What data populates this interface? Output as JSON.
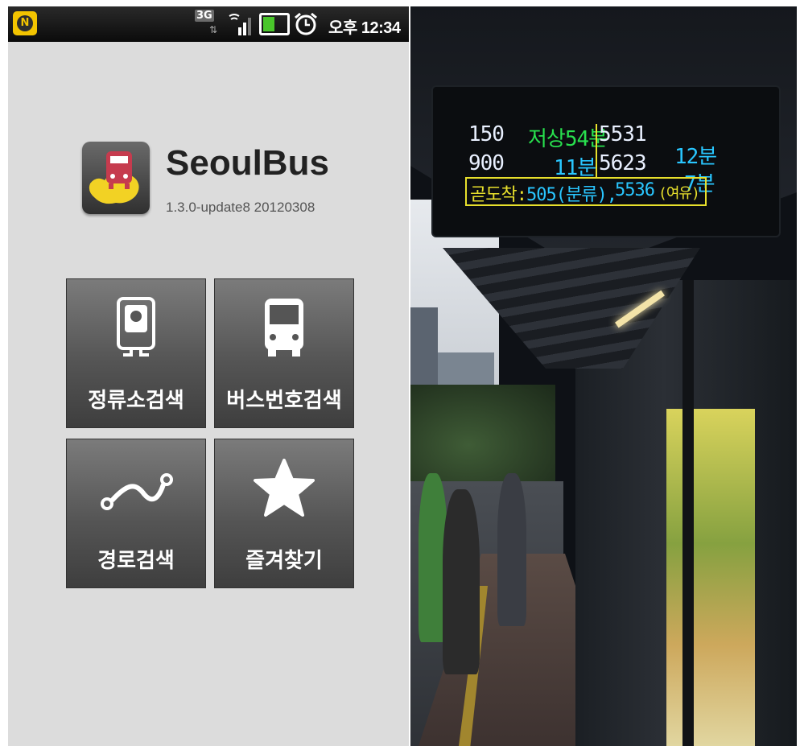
{
  "status_bar": {
    "notification_icon": "N",
    "network": "3G",
    "time": "오후 12:34"
  },
  "app": {
    "title": "SeoulBus",
    "version": "1.3.0-update8 20120308",
    "logo_icon": "bus-map-logo-icon"
  },
  "menu": {
    "stop_search": {
      "label": "정류소검색",
      "icon": "bus-stop-icon"
    },
    "bus_number_search": {
      "label": "버스번호검색",
      "icon": "bus-icon"
    },
    "route_search": {
      "label": "경로검색",
      "icon": "route-icon"
    },
    "favorites": {
      "label": "즐겨찾기",
      "icon": "star-icon"
    }
  },
  "led_display": {
    "rows": [
      {
        "route": "150",
        "status": "저상54분",
        "route2": "5531",
        "time2": "12분"
      },
      {
        "route": "900",
        "status": "11분",
        "route2": "5623",
        "time2": "7분"
      }
    ],
    "arriving_label": "곧도착:",
    "arriving_1": "505(분류),",
    "arriving_2": "5536",
    "arriving_2_status": "(여유)"
  },
  "colors": {
    "status_bar_bg": "#111111",
    "screen_bg": "#dcdcdc",
    "button_bg": "#555555",
    "led_white": "#e9f0ff",
    "led_green": "#28e04e",
    "led_cyan": "#29c6ff",
    "led_yellow": "#e8e02c"
  }
}
